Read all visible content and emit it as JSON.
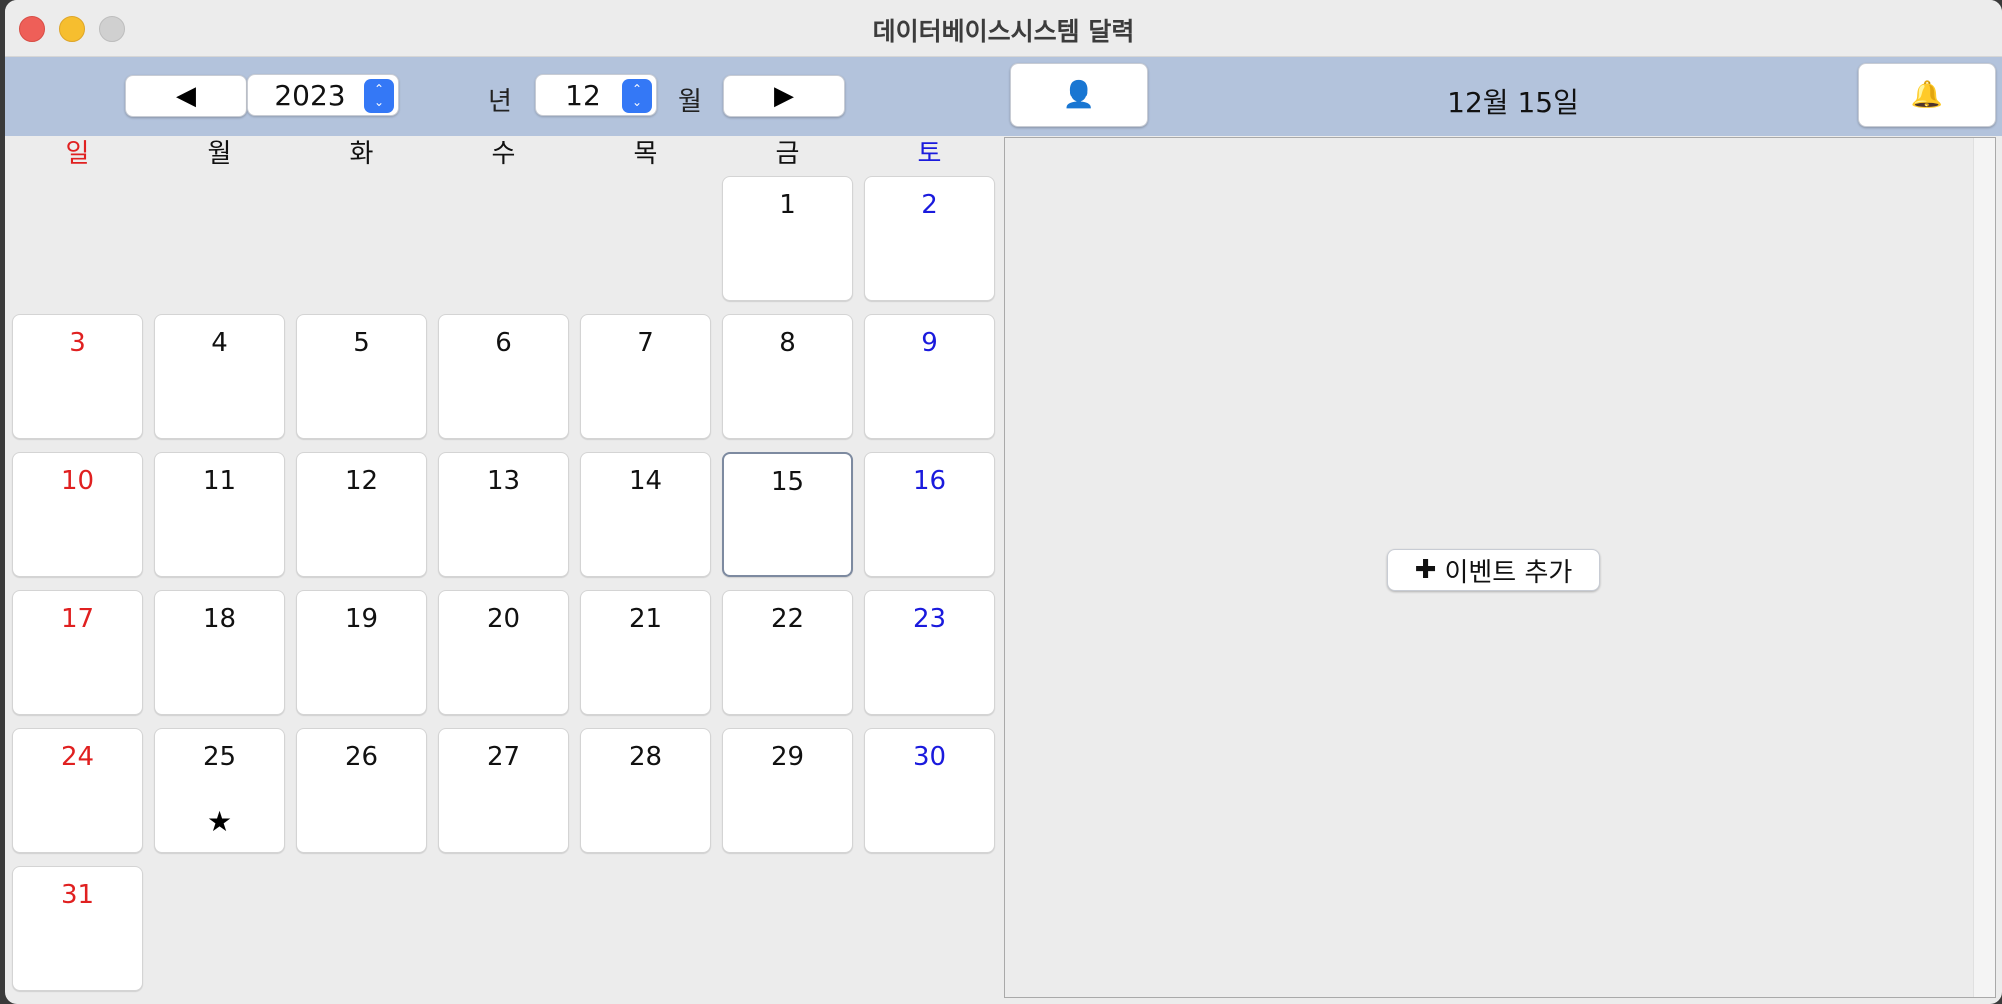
{
  "window": {
    "title": "데이터베이스시스템 달력"
  },
  "toolbar": {
    "prev_icon": "◀",
    "next_icon": "▶",
    "year_value": "2023",
    "year_unit": "년",
    "month_value": "12",
    "month_unit": "월",
    "spinner_up": "⌃",
    "spinner_down": "⌄",
    "profile_icon": "👤",
    "selected_date": "12월 15일",
    "bell_icon": "🔔"
  },
  "calendar": {
    "weekdays": [
      "일",
      "월",
      "화",
      "수",
      "목",
      "금",
      "토"
    ],
    "days": [
      "1",
      "2",
      "3",
      "4",
      "5",
      "6",
      "7",
      "8",
      "9",
      "10",
      "11",
      "12",
      "13",
      "14",
      "15",
      "16",
      "17",
      "18",
      "19",
      "20",
      "21",
      "22",
      "23",
      "24",
      "25",
      "26",
      "27",
      "28",
      "29",
      "30",
      "31"
    ],
    "selected_day": "15",
    "star_mark": "★",
    "sunday_color": "#e02020",
    "saturday_color": "#1a1add"
  },
  "event_panel": {
    "add_event_icon": "✚",
    "add_event_label": "이벤트 추가"
  }
}
